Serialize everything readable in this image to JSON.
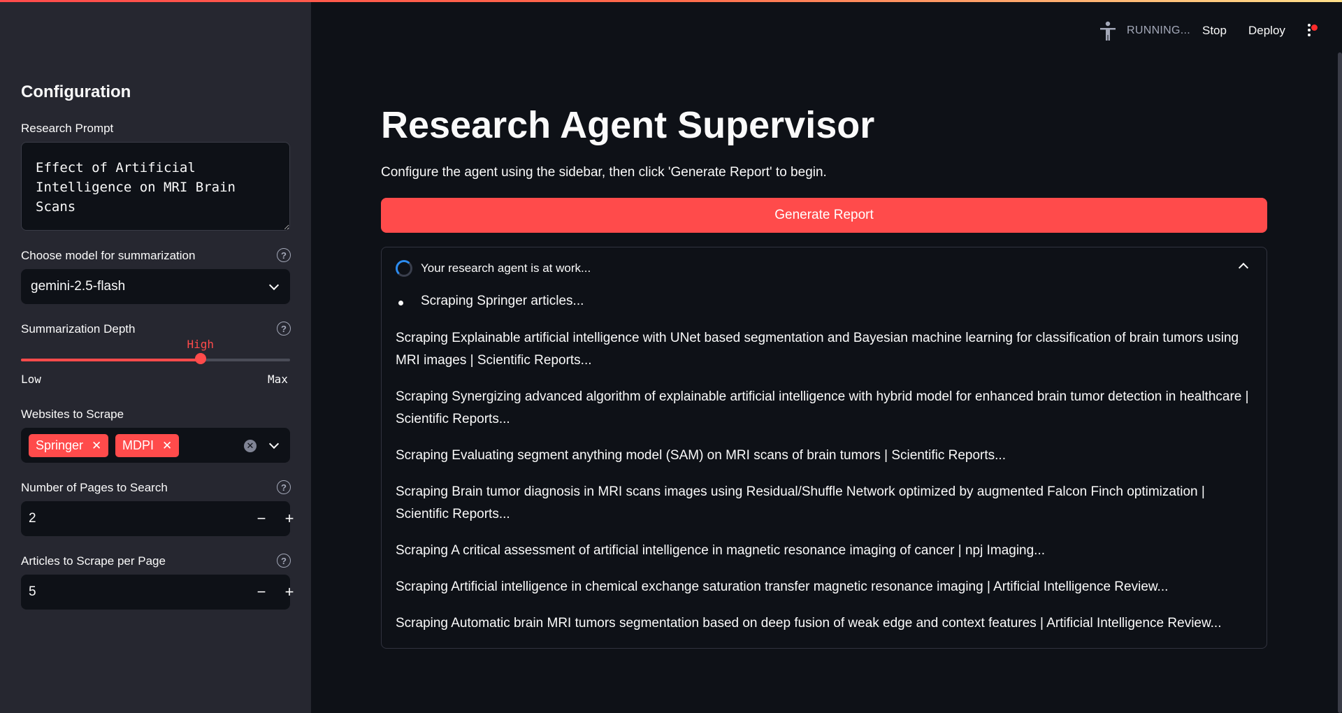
{
  "sidebar": {
    "title": "Configuration",
    "research_prompt": {
      "label": "Research Prompt",
      "value": "Effect of Artificial Intelligence on MRI Brain Scans"
    },
    "model": {
      "label": "Choose model for summarization",
      "selected": "gemini-2.5-flash"
    },
    "depth": {
      "label": "Summarization Depth",
      "value": "High",
      "min_label": "Low",
      "max_label": "Max",
      "level_fraction": 0.667
    },
    "websites": {
      "label": "Websites to Scrape",
      "tags": [
        "Springer",
        "MDPI"
      ]
    },
    "pages": {
      "label": "Number of Pages to Search",
      "value": "2"
    },
    "articles": {
      "label": "Articles to Scrape per Page",
      "value": "5"
    }
  },
  "header": {
    "status": "RUNNING...",
    "stop_label": "Stop",
    "deploy_label": "Deploy"
  },
  "main": {
    "title": "Research Agent Supervisor",
    "intro": "Configure the agent using the sidebar, then click 'Generate Report' to begin.",
    "generate_label": "Generate Report",
    "status_label": "Your research agent is at work...",
    "bullet": "Scraping Springer articles...",
    "log": [
      "Scraping Explainable artificial intelligence with UNet based segmentation and Bayesian machine learning for classification of brain tumors using MRI images | Scientific Reports...",
      "Scraping Synergizing advanced algorithm of explainable artificial intelligence with hybrid model for enhanced brain tumor detection in healthcare | Scientific Reports...",
      "Scraping Evaluating segment anything model (SAM) on MRI scans of brain tumors | Scientific Reports...",
      "Scraping Brain tumor diagnosis in MRI scans images using Residual/Shuffle Network optimized by augmented Falcon Finch optimization | Scientific Reports...",
      "Scraping A critical assessment of artificial intelligence in magnetic resonance imaging of cancer | npj Imaging...",
      "Scraping Artificial intelligence in chemical exchange saturation transfer magnetic resonance imaging | Artificial Intelligence Review...",
      "Scraping Automatic brain MRI tumors segmentation based on deep fusion of weak edge and context features | Artificial Intelligence Review..."
    ]
  },
  "colors": {
    "accent": "#ff4b4b",
    "background": "#0e1117",
    "sidebar": "#262730",
    "spinner": "#2c8cf0"
  }
}
